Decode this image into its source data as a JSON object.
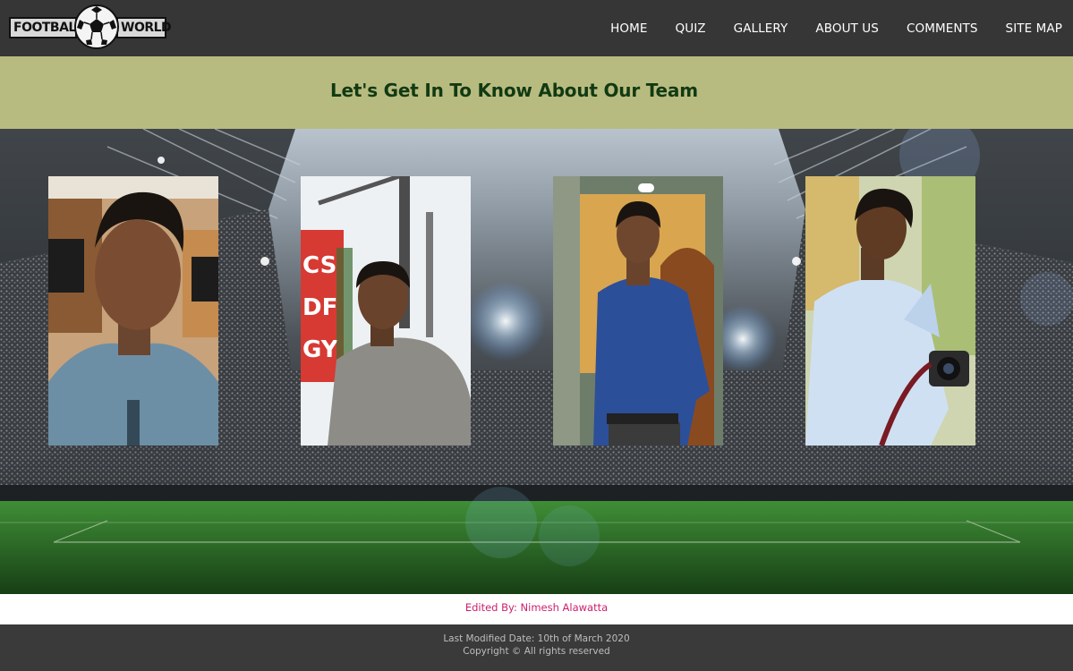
{
  "logo": {
    "left_text": "FOOTBALL",
    "right_text": "WORLD"
  },
  "nav": [
    "HOME",
    "QUIZ",
    "GALLERY",
    "ABOUT US",
    "COMMENTS",
    "SITE MAP"
  ],
  "title": "Let's Get In To Know About Our Team",
  "photo_signs": {
    "sign_lines": [
      "CS",
      "DF",
      "GY"
    ]
  },
  "editor": "Edited By: Nimesh Alawatta",
  "footer": {
    "modified": "Last Modified Date: 10th of March 2020",
    "copyright": "Copyright © All rights reserved"
  },
  "colors": {
    "header_bg": "#363636",
    "band_bg": "#b8bb80",
    "title_color": "#123a12",
    "editor_color": "#cc1f6c",
    "footer_bg": "#3a3a3a"
  }
}
